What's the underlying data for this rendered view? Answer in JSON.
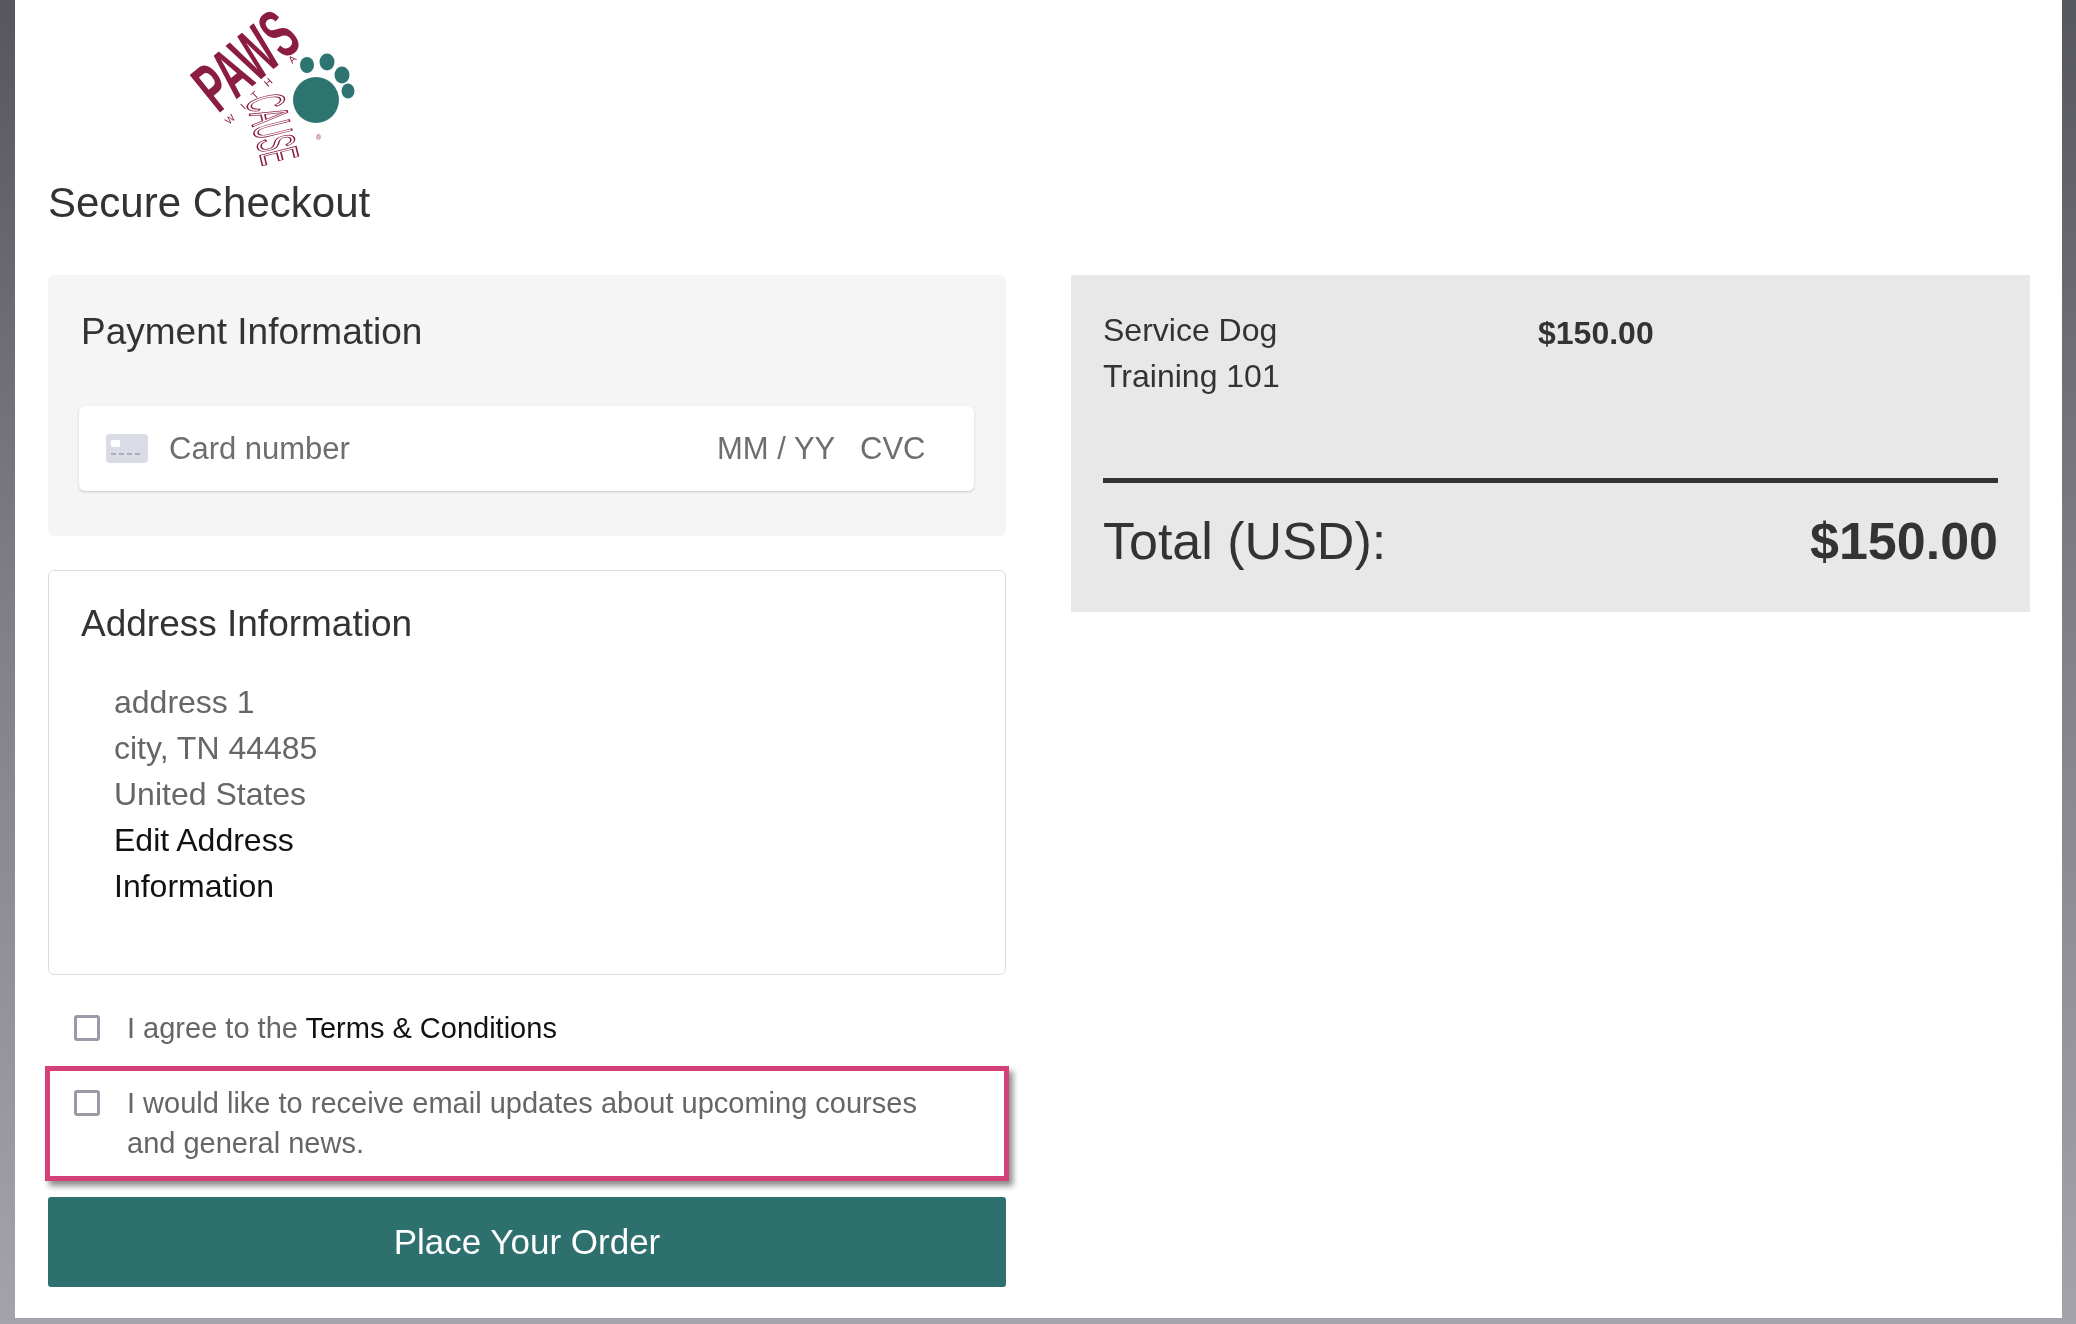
{
  "logo": {
    "title": "PAWS",
    "connector": "WITH A",
    "tagline": "CAUSE",
    "mark": "®"
  },
  "heading": "Secure Checkout",
  "payment": {
    "title": "Payment Information",
    "card_field": {
      "placeholder": "Card number",
      "expiry_placeholder": "MM / YY",
      "cvc_placeholder": "CVC"
    }
  },
  "address": {
    "title": "Address Information",
    "lines": [
      "address 1",
      "city, TN 44485",
      "United States"
    ],
    "edit_link": "Edit Address Information"
  },
  "consents": [
    {
      "label": "I agree to the",
      "link": "Terms & Conditions",
      "checked": false,
      "highlighted": false
    },
    {
      "label": "I would like to receive email updates about upcoming courses and general news.",
      "checked": false,
      "highlighted": true
    }
  ],
  "order_button": "Place Your Order",
  "summary": {
    "items": [
      {
        "name": "Service Dog Training 101",
        "price": "$150.00"
      }
    ],
    "total_label": "Total (USD):",
    "total": "$150.00"
  }
}
